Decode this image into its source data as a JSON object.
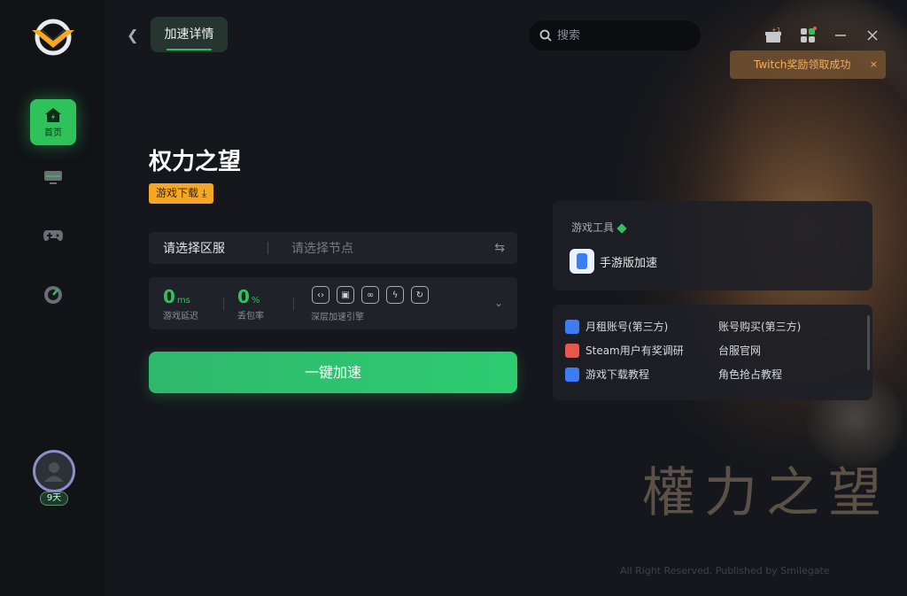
{
  "window": {
    "title_tab": "加速详情"
  },
  "search": {
    "placeholder": "搜索"
  },
  "toast": {
    "message": "Twitch奖励领取成功",
    "close": "×"
  },
  "topbar": {
    "gift_badge": "+1"
  },
  "sidebar": {
    "items": [
      {
        "label": "首页",
        "icon": "home-icon",
        "active": true
      },
      {
        "label": "",
        "icon": "monitor-icon",
        "active": false
      },
      {
        "label": "",
        "icon": "gamepad-icon",
        "active": false
      },
      {
        "label": "",
        "icon": "speedometer-icon",
        "active": false
      }
    ],
    "user": {
      "days_badge": "9天"
    }
  },
  "game": {
    "title": "权力之望",
    "download_label": "游戏下载 ⤓",
    "server_label": "请选择区服",
    "node_placeholder": "请选择节点"
  },
  "stats": {
    "latency_value": "0",
    "latency_unit": "ms",
    "latency_label": "游戏延迟",
    "loss_value": "0",
    "loss_unit": "%",
    "loss_label": "丢包率",
    "engine_label": "深层加速引擎"
  },
  "accelerate_button": "一键加速",
  "tools": {
    "heading": "游戏工具",
    "item": "手游版加速"
  },
  "links": [
    {
      "label": "月租账号(第三方)",
      "icon": "blue"
    },
    {
      "label": "账号购买(第三方)",
      "icon": ""
    },
    {
      "label": "Steam用户有奖调研",
      "icon": "red"
    },
    {
      "label": "台服官网",
      "icon": ""
    },
    {
      "label": "游戏下载教程",
      "icon": "blue"
    },
    {
      "label": "角色抢占教程",
      "icon": ""
    }
  ],
  "background": {
    "art_title": "權力之望",
    "copyright": "All Right Reserved. Published by Smilegate"
  },
  "colors": {
    "accent": "#2fc25b",
    "download": "#f5a623",
    "toast_text": "#f5b05a"
  }
}
